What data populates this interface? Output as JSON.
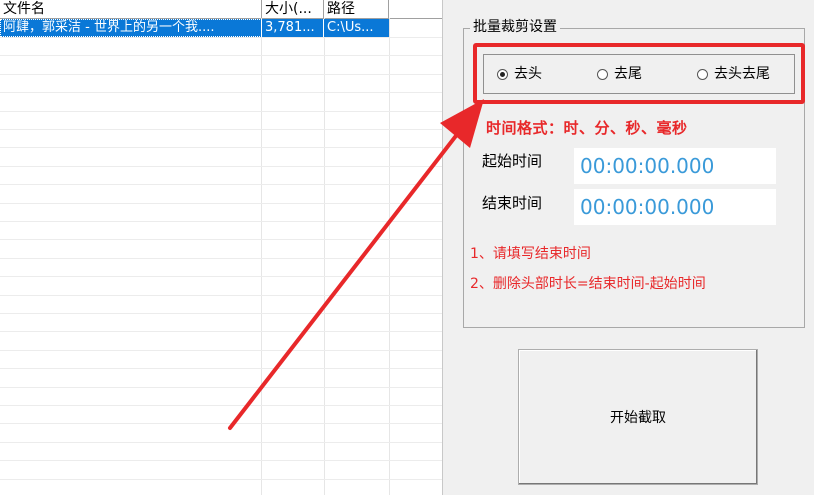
{
  "file_list": {
    "columns": [
      "文件名",
      "大小(...",
      "路径"
    ],
    "rows": [
      {
        "name": "阿肆，郭采洁 - 世界上的另一个我....",
        "size": "3,781...",
        "path": "C:\\Us..."
      }
    ]
  },
  "settings": {
    "group_title": "批量裁剪设置",
    "mode_options": [
      "去头",
      "去尾",
      "去头去尾"
    ],
    "selected_mode": "去头",
    "time_format": "时间格式：时、分、秒、毫秒",
    "start_label": "起始时间",
    "start_value": "00:00:00.000",
    "end_label": "结束时间",
    "end_value": "00:00:00.000",
    "notes": [
      "1、请填写结束时间",
      "2、删除头部时长=结束时间-起始时间"
    ]
  },
  "actions": {
    "start_label": "开始截取"
  },
  "colors": {
    "highlight_red": "#e8282a",
    "selection_blue": "#0a78d7",
    "time_blue": "#3a9ad9"
  }
}
